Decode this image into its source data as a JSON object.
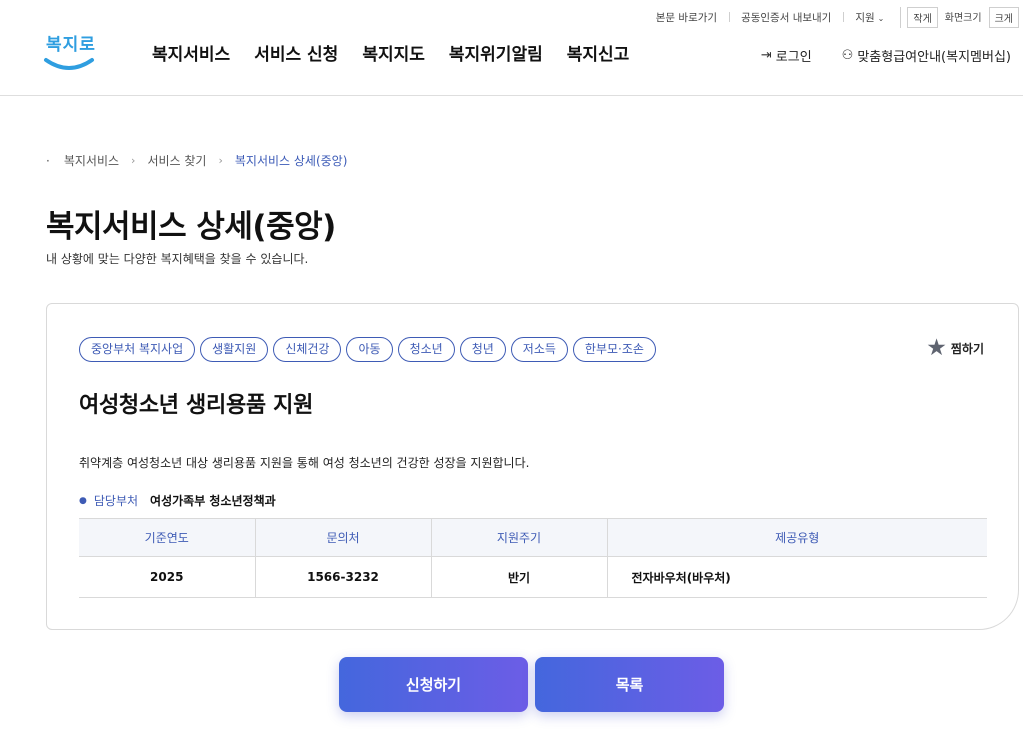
{
  "utility": {
    "links": [
      "본문 바로가기",
      "공동인증서 내보내기",
      "지원"
    ],
    "font_sizes": [
      "작게",
      "화면크기",
      "크게"
    ]
  },
  "logo": {
    "text": "복지로",
    "icon": "smile-logo"
  },
  "gnb": [
    "복지서비스",
    "서비스 신청",
    "복지지도",
    "복지위기알림",
    "복지신고"
  ],
  "header_right": {
    "login": "로그인",
    "login_icon": "login-icon",
    "member": "맞춤형급여안내(복지멤버십)",
    "member_icon": "user-plus-icon"
  },
  "breadcrumb": [
    "복지서비스",
    "서비스 찾기",
    "복지서비스 상세(중앙)"
  ],
  "page": {
    "title": "복지서비스 상세(중앙)",
    "subtitle": "내 상황에 맞는 다양한 복지혜택을 찾을 수 있습니다."
  },
  "service": {
    "tags": [
      "중앙부처 복지사업",
      "생활지원",
      "신체건강",
      "아동",
      "청소년",
      "청년",
      "저소득",
      "한부모·조손"
    ],
    "favorite_label": "찜하기",
    "title": "여성청소년 생리용품 지원",
    "description": "취약계층 여성청소년 대상 생리용품 지원을 통해 여성 청소년의 건강한 성장을 지원합니다.",
    "dept_label": "담당부처",
    "dept_value": "여성가족부 청소년정책과",
    "table": {
      "headers": [
        "기준연도",
        "문의처",
        "지원주기",
        "제공유형"
      ],
      "row": [
        "2025",
        "1566-3232",
        "반기",
        "전자바우처(바우처)"
      ]
    }
  },
  "buttons": {
    "apply": "신청하기",
    "list": "목록"
  },
  "colors": {
    "accent": "#3e5bb5",
    "button_start": "#4467dd",
    "button_end": "#6c5de6",
    "logo": "#2f9ee0"
  }
}
